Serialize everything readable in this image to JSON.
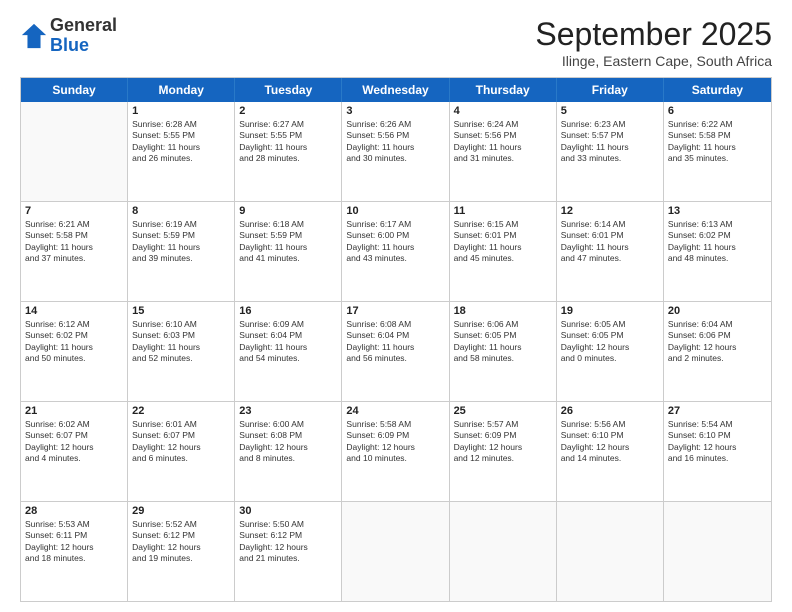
{
  "logo": {
    "general": "General",
    "blue": "Blue"
  },
  "title": "September 2025",
  "subtitle": "Ilinge, Eastern Cape, South Africa",
  "header_days": [
    "Sunday",
    "Monday",
    "Tuesday",
    "Wednesday",
    "Thursday",
    "Friday",
    "Saturday"
  ],
  "weeks": [
    [
      {
        "day": "",
        "info": ""
      },
      {
        "day": "1",
        "info": "Sunrise: 6:28 AM\nSunset: 5:55 PM\nDaylight: 11 hours\nand 26 minutes."
      },
      {
        "day": "2",
        "info": "Sunrise: 6:27 AM\nSunset: 5:55 PM\nDaylight: 11 hours\nand 28 minutes."
      },
      {
        "day": "3",
        "info": "Sunrise: 6:26 AM\nSunset: 5:56 PM\nDaylight: 11 hours\nand 30 minutes."
      },
      {
        "day": "4",
        "info": "Sunrise: 6:24 AM\nSunset: 5:56 PM\nDaylight: 11 hours\nand 31 minutes."
      },
      {
        "day": "5",
        "info": "Sunrise: 6:23 AM\nSunset: 5:57 PM\nDaylight: 11 hours\nand 33 minutes."
      },
      {
        "day": "6",
        "info": "Sunrise: 6:22 AM\nSunset: 5:58 PM\nDaylight: 11 hours\nand 35 minutes."
      }
    ],
    [
      {
        "day": "7",
        "info": "Sunrise: 6:21 AM\nSunset: 5:58 PM\nDaylight: 11 hours\nand 37 minutes."
      },
      {
        "day": "8",
        "info": "Sunrise: 6:19 AM\nSunset: 5:59 PM\nDaylight: 11 hours\nand 39 minutes."
      },
      {
        "day": "9",
        "info": "Sunrise: 6:18 AM\nSunset: 5:59 PM\nDaylight: 11 hours\nand 41 minutes."
      },
      {
        "day": "10",
        "info": "Sunrise: 6:17 AM\nSunset: 6:00 PM\nDaylight: 11 hours\nand 43 minutes."
      },
      {
        "day": "11",
        "info": "Sunrise: 6:15 AM\nSunset: 6:01 PM\nDaylight: 11 hours\nand 45 minutes."
      },
      {
        "day": "12",
        "info": "Sunrise: 6:14 AM\nSunset: 6:01 PM\nDaylight: 11 hours\nand 47 minutes."
      },
      {
        "day": "13",
        "info": "Sunrise: 6:13 AM\nSunset: 6:02 PM\nDaylight: 11 hours\nand 48 minutes."
      }
    ],
    [
      {
        "day": "14",
        "info": "Sunrise: 6:12 AM\nSunset: 6:02 PM\nDaylight: 11 hours\nand 50 minutes."
      },
      {
        "day": "15",
        "info": "Sunrise: 6:10 AM\nSunset: 6:03 PM\nDaylight: 11 hours\nand 52 minutes."
      },
      {
        "day": "16",
        "info": "Sunrise: 6:09 AM\nSunset: 6:04 PM\nDaylight: 11 hours\nand 54 minutes."
      },
      {
        "day": "17",
        "info": "Sunrise: 6:08 AM\nSunset: 6:04 PM\nDaylight: 11 hours\nand 56 minutes."
      },
      {
        "day": "18",
        "info": "Sunrise: 6:06 AM\nSunset: 6:05 PM\nDaylight: 11 hours\nand 58 minutes."
      },
      {
        "day": "19",
        "info": "Sunrise: 6:05 AM\nSunset: 6:05 PM\nDaylight: 12 hours\nand 0 minutes."
      },
      {
        "day": "20",
        "info": "Sunrise: 6:04 AM\nSunset: 6:06 PM\nDaylight: 12 hours\nand 2 minutes."
      }
    ],
    [
      {
        "day": "21",
        "info": "Sunrise: 6:02 AM\nSunset: 6:07 PM\nDaylight: 12 hours\nand 4 minutes."
      },
      {
        "day": "22",
        "info": "Sunrise: 6:01 AM\nSunset: 6:07 PM\nDaylight: 12 hours\nand 6 minutes."
      },
      {
        "day": "23",
        "info": "Sunrise: 6:00 AM\nSunset: 6:08 PM\nDaylight: 12 hours\nand 8 minutes."
      },
      {
        "day": "24",
        "info": "Sunrise: 5:58 AM\nSunset: 6:09 PM\nDaylight: 12 hours\nand 10 minutes."
      },
      {
        "day": "25",
        "info": "Sunrise: 5:57 AM\nSunset: 6:09 PM\nDaylight: 12 hours\nand 12 minutes."
      },
      {
        "day": "26",
        "info": "Sunrise: 5:56 AM\nSunset: 6:10 PM\nDaylight: 12 hours\nand 14 minutes."
      },
      {
        "day": "27",
        "info": "Sunrise: 5:54 AM\nSunset: 6:10 PM\nDaylight: 12 hours\nand 16 minutes."
      }
    ],
    [
      {
        "day": "28",
        "info": "Sunrise: 5:53 AM\nSunset: 6:11 PM\nDaylight: 12 hours\nand 18 minutes."
      },
      {
        "day": "29",
        "info": "Sunrise: 5:52 AM\nSunset: 6:12 PM\nDaylight: 12 hours\nand 19 minutes."
      },
      {
        "day": "30",
        "info": "Sunrise: 5:50 AM\nSunset: 6:12 PM\nDaylight: 12 hours\nand 21 minutes."
      },
      {
        "day": "",
        "info": ""
      },
      {
        "day": "",
        "info": ""
      },
      {
        "day": "",
        "info": ""
      },
      {
        "day": "",
        "info": ""
      }
    ]
  ]
}
